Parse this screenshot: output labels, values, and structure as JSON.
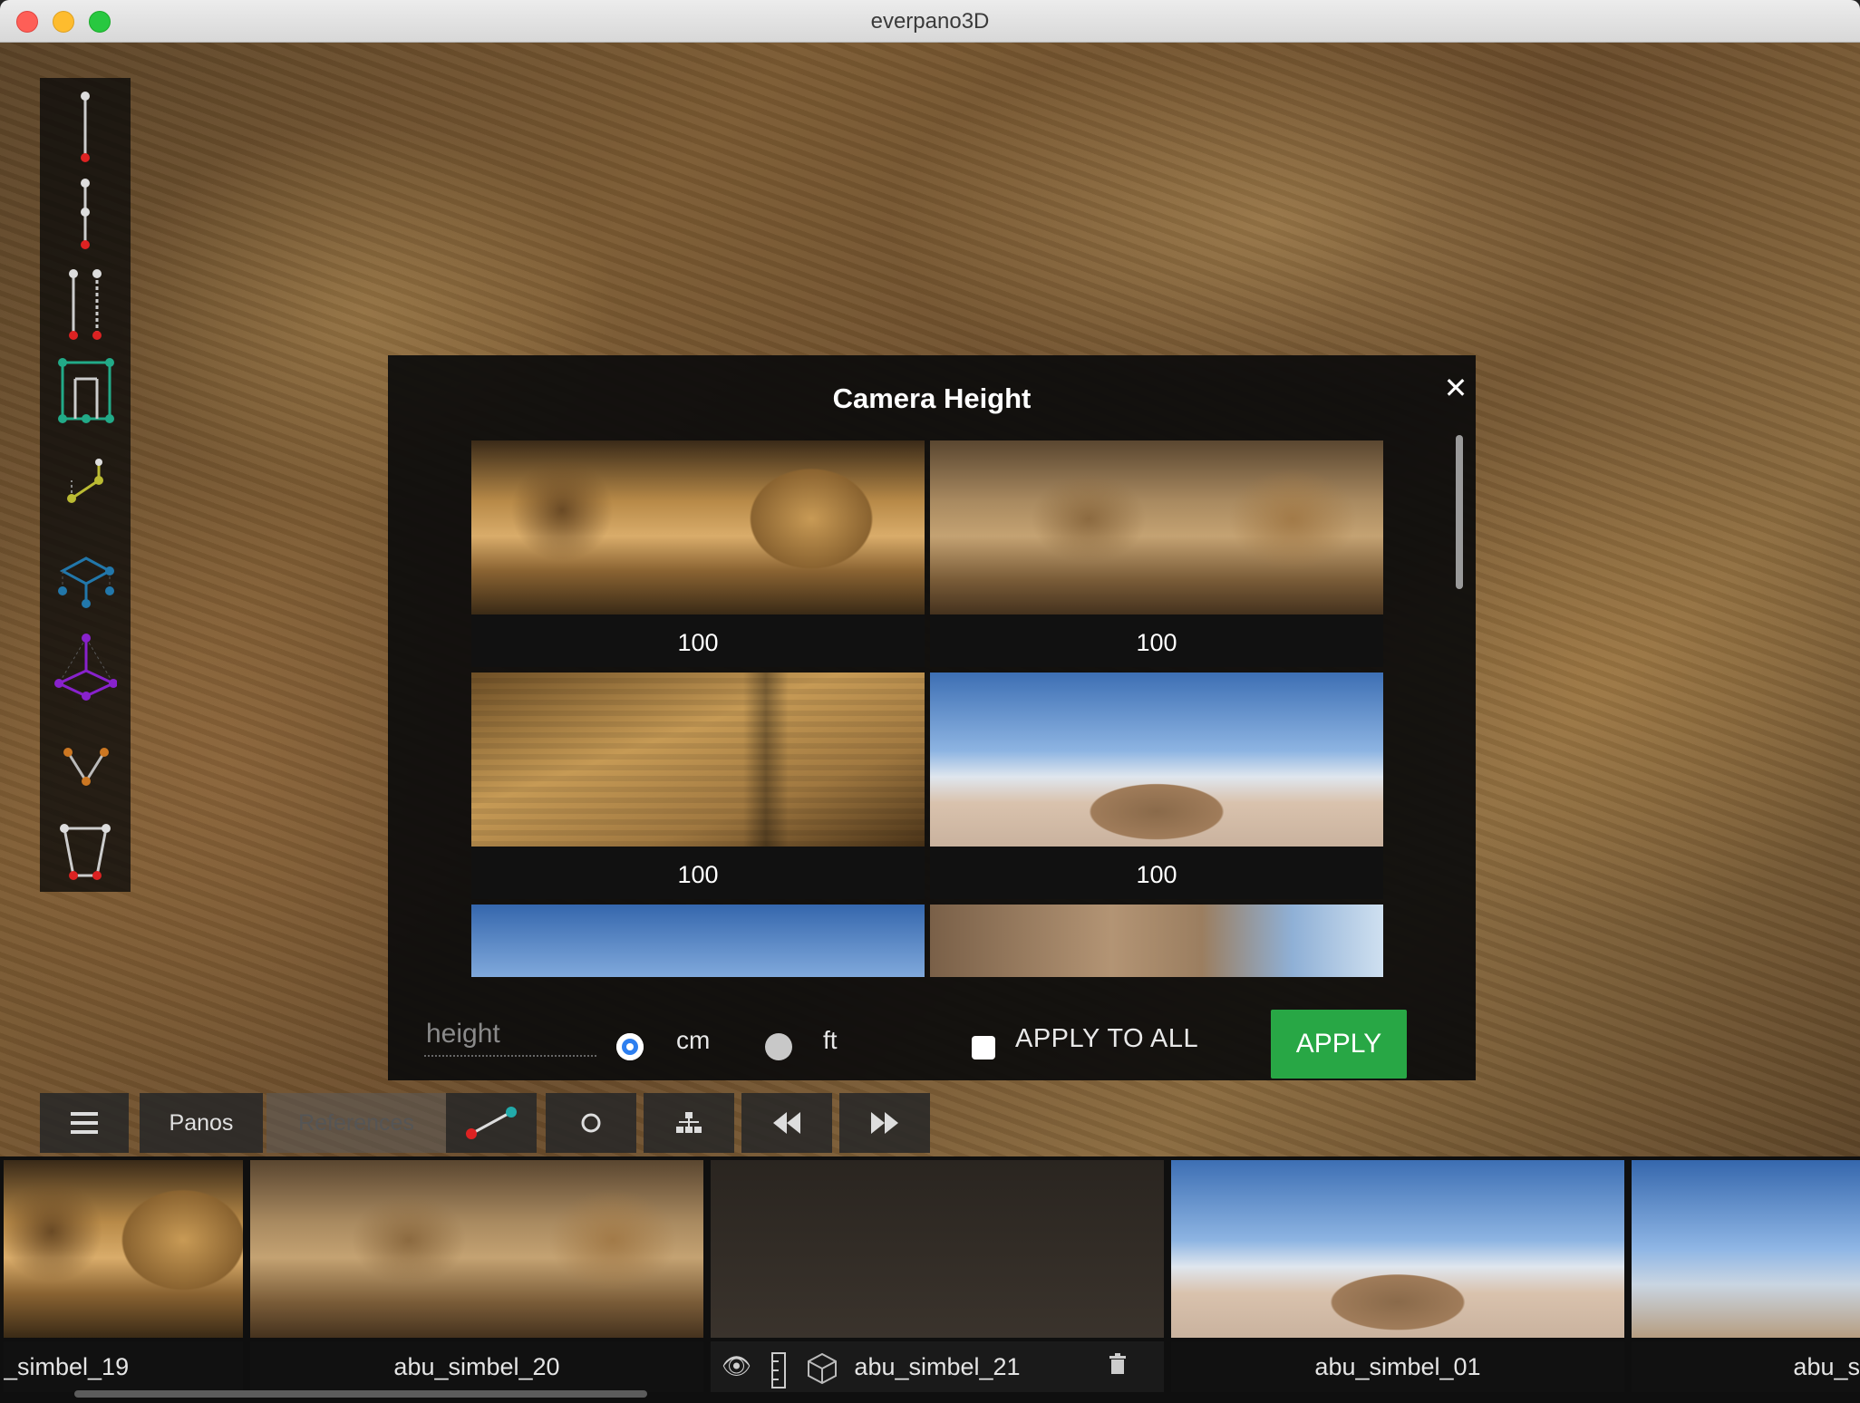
{
  "window": {
    "title": "everpano3D"
  },
  "modal": {
    "title": "Camera Height",
    "close_icon": "close-icon",
    "thumbnails": [
      {
        "value": "100",
        "style": "img-interior"
      },
      {
        "value": "100",
        "style": "img-interior2"
      },
      {
        "value": "100",
        "style": "img-hall"
      },
      {
        "value": "100",
        "style": "img-sky"
      },
      {
        "value": "",
        "style": "img-sky2"
      },
      {
        "value": "",
        "style": "img-temple"
      }
    ],
    "height_placeholder": "height",
    "units": {
      "cm": "cm",
      "ft": "ft",
      "selected": "cm"
    },
    "apply_to_all_label": "APPLY TO ALL",
    "apply_label": "APPLY",
    "colors": {
      "apply": "#28a745",
      "radio_selected": "#2d7ff0"
    }
  },
  "bottom_toolbar": {
    "menu_icon": "menu-icon",
    "panos_tab": "Panos",
    "references_tab": "References",
    "tools": [
      "measure-line-icon",
      "circle-icon",
      "hierarchy-icon",
      "rewind-icon",
      "fast-forward-icon"
    ]
  },
  "filmstrip": [
    {
      "name": "_simbel_19"
    },
    {
      "name": "abu_simbel_20"
    },
    {
      "name": "abu_simbel_21"
    },
    {
      "name": "abu_simbel_01"
    },
    {
      "name": "abu_s"
    }
  ],
  "left_tools": [
    "vertical-line-tool-icon",
    "vertical-segment-tool-icon",
    "parallel-lines-tool-icon",
    "floorplan-tool-icon",
    "plane-tool-icon",
    "box-tool-icon",
    "pyramid-tool-icon",
    "angle-tool-icon",
    "frustum-tool-icon"
  ]
}
